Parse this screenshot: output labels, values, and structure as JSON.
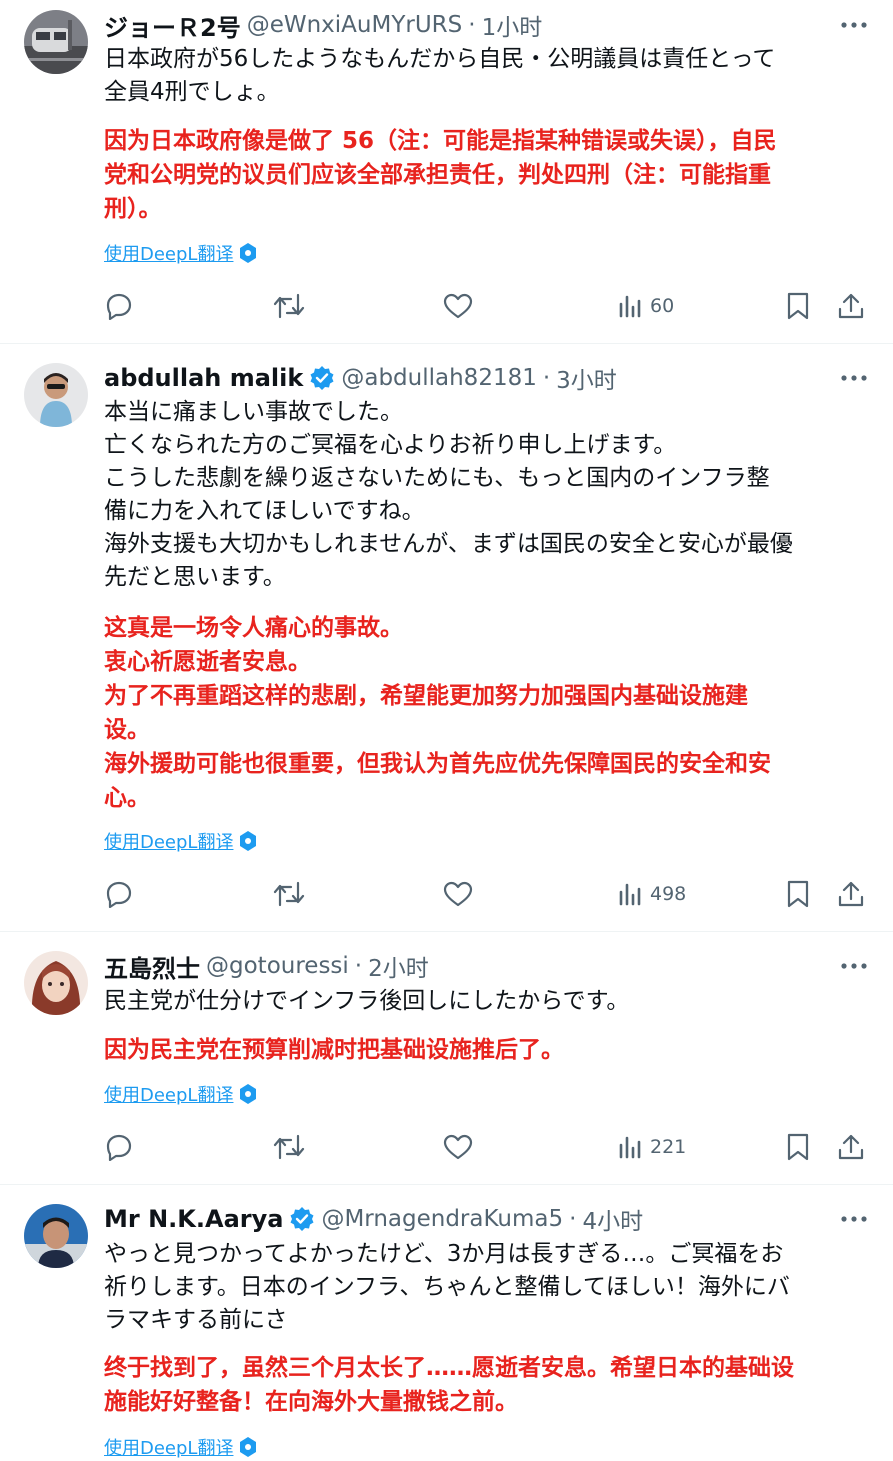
{
  "tweets": [
    {
      "name": "ジョーＲ2号",
      "handle": "@eWnxiAuMYrURS",
      "dot": "·",
      "time": "1小时",
      "verified": false,
      "text": [
        "日本政府が56したようなもんだから自民・公明議員は責任とって",
        "全員4刑でしょ。"
      ],
      "translation": [
        "因为日本政府像是做了 56（注：可能是指某种错误或失误），自民",
        "党和公明党的议员们应该全部承担责任，判处四刑（注：可能指重",
        "刑）。"
      ],
      "deepl_label": "使用DeepL翻译",
      "views": "60"
    },
    {
      "name": "abdullah malik",
      "handle": "@abdullah82181",
      "dot": "·",
      "time": "3小时",
      "verified": true,
      "text": [
        "本当に痛ましい事故でした。",
        "亡くなられた方のご冥福を心よりお祈り申し上げます。",
        "こうした悲劇を繰り返さないためにも、もっと国内のインフラ整",
        "備に力を入れてほしいですね。",
        "海外支援も大切かもしれませんが、まずは国民の安全と安心が最優",
        "先だと思います。"
      ],
      "translation": [
        "这真是一场令人痛心的事故。",
        "衷心祈愿逝者安息。",
        "为了不再重蹈这样的悲剧，希望能更加努力加强国内基础设施建",
        "设。",
        "海外援助可能也很重要，但我认为首先应优先保障国民的安全和安",
        "心。"
      ],
      "deepl_label": "使用DeepL翻译",
      "views": "498"
    },
    {
      "name": "五島烈士",
      "handle": "@gotouressi",
      "dot": "·",
      "time": "2小时",
      "verified": false,
      "text": [
        "民主党が仕分けでインフラ後回しにしたからです。"
      ],
      "translation": [
        "因为民主党在预算削减时把基础设施推后了。"
      ],
      "deepl_label": "使用DeepL翻译",
      "views": "221"
    },
    {
      "name": "Mr N.K.Aarya",
      "handle": "@MrnagendraKuma5",
      "dot": "·",
      "time": "4小时",
      "verified": true,
      "text": [
        "やっと見つかってよかったけど、3か月は長すぎる…。ご冥福をお",
        "祈りします。日本のインフラ、ちゃんと整備してほしい！海外にバ",
        "ラマキする前にさ"
      ],
      "translation": [
        "终于找到了，虽然三个月太长了……愿逝者安息。希望日本的基础设",
        "施能好好整备！在向海外大量撒钱之前。"
      ],
      "deepl_label": "使用DeepL翻译",
      "views": null
    }
  ],
  "colors": {
    "translation": "#e8231e",
    "link": "#1d9bf0",
    "secondary": "#536471",
    "verified": "#1d9bf0"
  }
}
